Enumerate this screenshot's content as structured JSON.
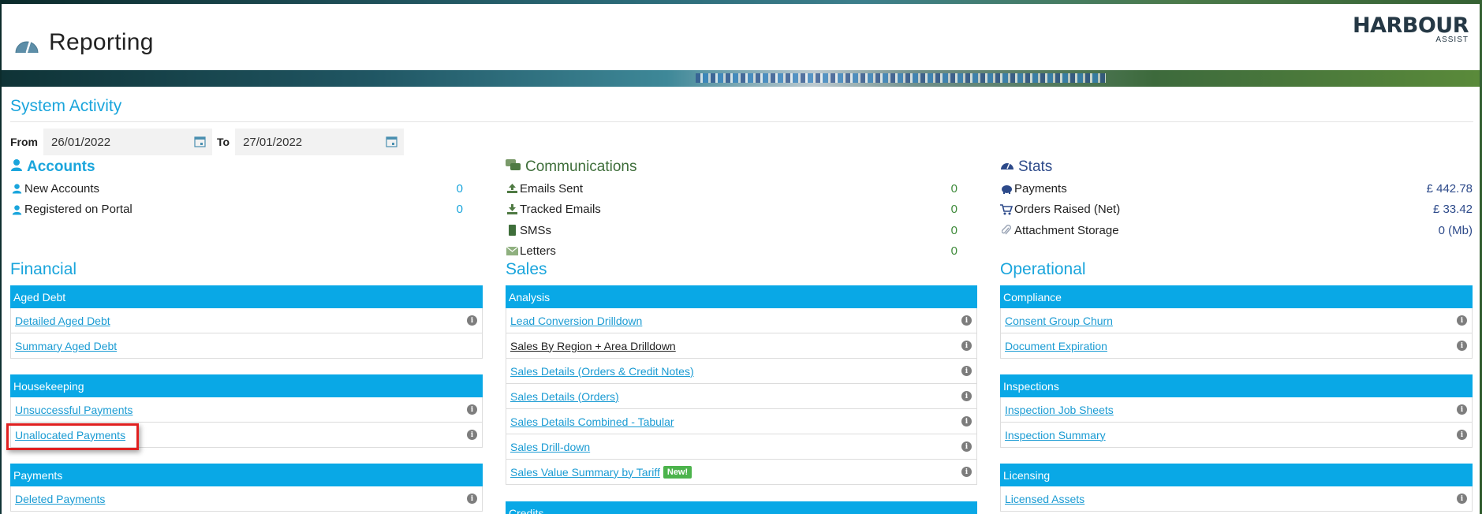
{
  "header": {
    "title": "Reporting",
    "logo_main": "HARBOUR",
    "logo_sub": "ASSIST"
  },
  "system_activity": {
    "title": "System Activity",
    "from_label": "From",
    "from_value": "26/01/2022",
    "to_label": "To",
    "to_value": "27/01/2022"
  },
  "accounts": {
    "title": "Accounts",
    "rows": [
      {
        "label": "New Accounts",
        "value": "0"
      },
      {
        "label": "Registered on Portal",
        "value": "0"
      }
    ]
  },
  "communications": {
    "title": "Communications",
    "rows": [
      {
        "label": "Emails Sent",
        "value": "0"
      },
      {
        "label": "Tracked Emails",
        "value": "0"
      },
      {
        "label": "SMSs",
        "value": "0"
      },
      {
        "label": "Letters",
        "value": "0"
      }
    ]
  },
  "stats": {
    "title": "Stats",
    "rows": [
      {
        "label": "Payments",
        "value": "£ 442.78"
      },
      {
        "label": "Orders Raised (Net)",
        "value": "£ 33.42"
      },
      {
        "label": "Attachment Storage",
        "value": "0 (Mb)"
      }
    ]
  },
  "financial": {
    "title": "Financial",
    "groups": [
      {
        "heading": "Aged Debt",
        "items": [
          "Detailed Aged Debt",
          "Summary Aged Debt"
        ]
      },
      {
        "heading": "Housekeeping",
        "items": [
          "Unsuccessful Payments",
          "Unallocated Payments"
        ]
      },
      {
        "heading": "Payments",
        "items": [
          "Deleted Payments"
        ]
      }
    ]
  },
  "sales": {
    "title": "Sales",
    "groups": [
      {
        "heading": "Analysis",
        "items": [
          "Lead Conversion Drilldown",
          "Sales By Region + Area Drilldown",
          "Sales Details (Orders & Credit Notes)",
          "Sales Details (Orders)",
          "Sales Details Combined - Tabular",
          "Sales Drill-down",
          "Sales Value Summary by Tariff"
        ],
        "new_badge": "New!"
      },
      {
        "heading": "Credits",
        "items": []
      }
    ]
  },
  "operational": {
    "title": "Operational",
    "groups": [
      {
        "heading": "Compliance",
        "items": [
          "Consent Group Churn",
          "Document Expiration"
        ]
      },
      {
        "heading": "Inspections",
        "items": [
          "Inspection Job Sheets",
          "Inspection Summary"
        ]
      },
      {
        "heading": "Licensing",
        "items": [
          "Licensed Assets"
        ]
      }
    ]
  },
  "colors": {
    "accent": "#09a8e6",
    "link": "#1a9bd3",
    "highlight": "#e02020",
    "new_badge": "#4cb34c"
  }
}
